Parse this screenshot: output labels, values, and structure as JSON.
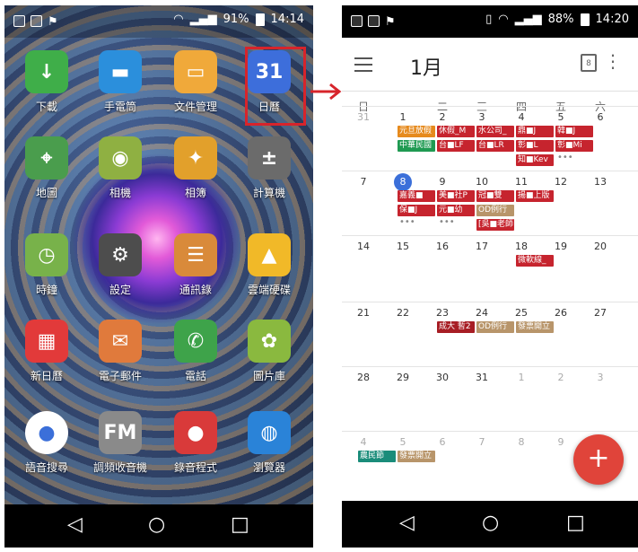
{
  "left": {
    "status": {
      "battery": "91%",
      "time": "14:14"
    },
    "apps": [
      {
        "label": "下載",
        "icon": "download-icon",
        "glyph": "↓",
        "color": "#3fae49"
      },
      {
        "label": "手電筒",
        "icon": "flashlight-icon",
        "glyph": "▬",
        "color": "#2b8fdc"
      },
      {
        "label": "文件管理",
        "icon": "folder-icon",
        "glyph": "▭",
        "color": "#f0a93a"
      },
      {
        "label": "日曆",
        "icon": "calendar-icon",
        "glyph": "31",
        "color": "#3d6edb"
      },
      {
        "label": "地圖",
        "icon": "map-icon",
        "glyph": "⌖",
        "color": "#4a9d4d"
      },
      {
        "label": "相機",
        "icon": "camera-icon",
        "glyph": "◉",
        "color": "#8fb042"
      },
      {
        "label": "相簿",
        "icon": "pinwheel-icon",
        "glyph": "✦",
        "color": "#e2a02b"
      },
      {
        "label": "計算機",
        "icon": "calculator-icon",
        "glyph": "±",
        "color": "#6b6b6b"
      },
      {
        "label": "時鐘",
        "icon": "clock-icon",
        "glyph": "◷",
        "color": "#78b24a"
      },
      {
        "label": "設定",
        "icon": "gear-icon",
        "glyph": "⚙",
        "color": "#4d4d4d"
      },
      {
        "label": "通訊錄",
        "icon": "contacts-icon",
        "glyph": "☰",
        "color": "#d98a3a"
      },
      {
        "label": "雲端硬碟",
        "icon": "drive-icon",
        "glyph": "▲",
        "color": "#f1b928"
      },
      {
        "label": "新日曆",
        "icon": "new-calendar-icon",
        "glyph": "▦",
        "color": "#e23a3a"
      },
      {
        "label": "電子郵件",
        "icon": "email-icon",
        "glyph": "✉",
        "color": "#e07a3c"
      },
      {
        "label": "電話",
        "icon": "phone-icon",
        "glyph": "✆",
        "color": "#3ea34a"
      },
      {
        "label": "圖片庫",
        "icon": "gallery-icon",
        "glyph": "✿",
        "color": "#8ab93f"
      },
      {
        "label": "語音搜尋",
        "icon": "mic-icon",
        "glyph": "●",
        "color": "#ffffff"
      },
      {
        "label": "調頻收音機",
        "icon": "radio-icon",
        "glyph": "FM",
        "color": "#8a8a8a"
      },
      {
        "label": "錄音程式",
        "icon": "record-icon",
        "glyph": "●",
        "color": "#d93a3a"
      },
      {
        "label": "瀏覽器",
        "icon": "globe-icon",
        "glyph": "◍",
        "color": "#2a83d8"
      }
    ]
  },
  "right": {
    "status": {
      "battery": "88%",
      "time": "14:20"
    },
    "month": "1月",
    "today_icon": "8",
    "weekdays": [
      "日",
      "一",
      "二",
      "三",
      "四",
      "五",
      "六"
    ],
    "weeks": [
      {
        "days": [
          "31",
          "1",
          "2",
          "3",
          "4",
          "5",
          "6"
        ],
        "dim": [
          true,
          false,
          false,
          false,
          false,
          false,
          false
        ]
      },
      {
        "days": [
          "7",
          "8",
          "9",
          "10",
          "11",
          "12",
          "13"
        ],
        "dim": [
          false,
          false,
          false,
          false,
          false,
          false,
          false
        ]
      },
      {
        "days": [
          "14",
          "15",
          "16",
          "17",
          "18",
          "19",
          "20"
        ],
        "dim": [
          false,
          false,
          false,
          false,
          false,
          false,
          false
        ]
      },
      {
        "days": [
          "21",
          "22",
          "23",
          "24",
          "25",
          "26",
          "27"
        ],
        "dim": [
          false,
          false,
          false,
          false,
          false,
          false,
          false
        ]
      },
      {
        "days": [
          "28",
          "29",
          "30",
          "31",
          "1",
          "2",
          "3"
        ],
        "dim": [
          false,
          false,
          false,
          false,
          true,
          true,
          true
        ]
      },
      {
        "days": [
          "4",
          "5",
          "6",
          "7",
          "8",
          "9",
          ""
        ],
        "dim": [
          true,
          true,
          true,
          true,
          true,
          true,
          true
        ]
      }
    ],
    "events": [
      {
        "text": "元旦放假",
        "col": 1,
        "week": 0,
        "line": 0,
        "color": "orange"
      },
      {
        "text": "中華民國",
        "col": 1,
        "week": 0,
        "line": 1,
        "color": "green"
      },
      {
        "text": "休假_M",
        "col": 2,
        "week": 0,
        "line": 0,
        "color": "red"
      },
      {
        "text": "台■LF",
        "col": 2,
        "week": 0,
        "line": 1,
        "color": "red"
      },
      {
        "text": "水公司_",
        "col": 3,
        "week": 0,
        "line": 0,
        "color": "red"
      },
      {
        "text": "台■LR",
        "col": 3,
        "week": 0,
        "line": 1,
        "color": "red"
      },
      {
        "text": "鼎■J",
        "col": 4,
        "week": 0,
        "line": 0,
        "color": "red"
      },
      {
        "text": "彰■L",
        "col": 4,
        "week": 0,
        "line": 1,
        "color": "red"
      },
      {
        "text": "知■Kev",
        "col": 4,
        "week": 0,
        "line": 2,
        "color": "red"
      },
      {
        "text": "韓■J",
        "col": 5,
        "week": 0,
        "line": 0,
        "color": "red"
      },
      {
        "text": "彰■Mi",
        "col": 5,
        "week": 0,
        "line": 1,
        "color": "red"
      },
      {
        "text": "嘉義■",
        "col": 1,
        "week": 1,
        "line": 0,
        "color": "red"
      },
      {
        "text": "保■J",
        "col": 1,
        "week": 1,
        "line": 1,
        "color": "red"
      },
      {
        "text": "美■社P",
        "col": 2,
        "week": 1,
        "line": 0,
        "color": "red"
      },
      {
        "text": "元■幼",
        "col": 2,
        "week": 1,
        "line": 1,
        "color": "red"
      },
      {
        "text": "冠■雙",
        "col": 3,
        "week": 1,
        "line": 0,
        "color": "red"
      },
      {
        "text": "OD例行",
        "col": 3,
        "week": 1,
        "line": 1,
        "color": "brown"
      },
      {
        "text": "[吳■老師",
        "col": 3,
        "week": 1,
        "line": 2,
        "color": "red"
      },
      {
        "text": "揚■上版",
        "col": 4,
        "week": 1,
        "line": 0,
        "color": "red"
      },
      {
        "text": "微軟線_",
        "col": 4,
        "week": 2,
        "line": 0,
        "color": "red"
      },
      {
        "text": "成大 暫2",
        "col": 2,
        "week": 3,
        "line": 0,
        "color": "dred"
      },
      {
        "text": "OD例行",
        "col": 3,
        "week": 3,
        "line": 0,
        "color": "brown"
      },
      {
        "text": "發票開立",
        "col": 4,
        "week": 3,
        "line": 0,
        "color": "brown"
      },
      {
        "text": "農民節",
        "col": 0,
        "week": 5,
        "line": 0,
        "color": "teal"
      },
      {
        "text": "發票開立",
        "col": 1,
        "week": 5,
        "line": 0,
        "color": "brown"
      }
    ],
    "fab_label": "+"
  },
  "nav": {
    "back": "◁",
    "home": "○",
    "recent": "□"
  }
}
